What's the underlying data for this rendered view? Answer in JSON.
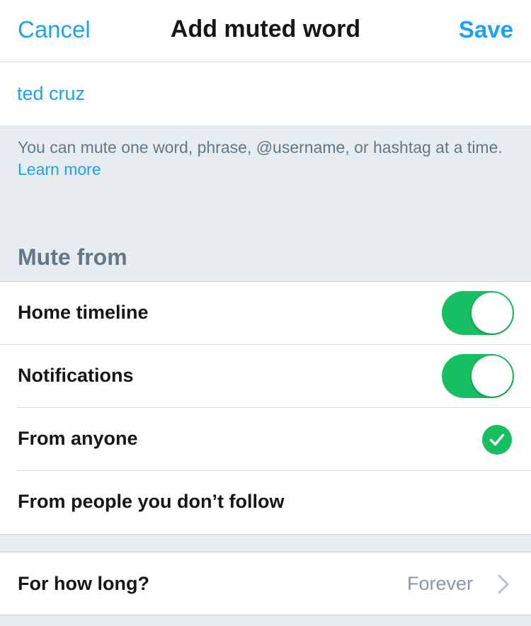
{
  "nav": {
    "cancel_label": "Cancel",
    "title": "Add muted word",
    "save_label": "Save"
  },
  "word_input": {
    "value": "ted cruz",
    "placeholder": ""
  },
  "helper": {
    "text": "You can mute one word, phrase, @username, or hashtag at a time.",
    "link_label": "Learn more"
  },
  "mute_from": {
    "header": "Mute from",
    "home_timeline": {
      "label": "Home timeline",
      "enabled": true
    },
    "notifications": {
      "label": "Notifications",
      "enabled": true
    },
    "from_anyone": {
      "label": "From anyone",
      "selected": true
    },
    "from_not_followed": {
      "label": "From people you don’t follow",
      "selected": false
    }
  },
  "duration": {
    "label": "For how long?",
    "value": "Forever"
  },
  "colors": {
    "accent": "#1da1f2",
    "toggle_on": "#17bf63",
    "background": "#e6ecf0",
    "secondary_text": "#657786"
  },
  "icons": {
    "check": "checkmark-circle-icon",
    "chevron": "chevron-right-icon"
  }
}
